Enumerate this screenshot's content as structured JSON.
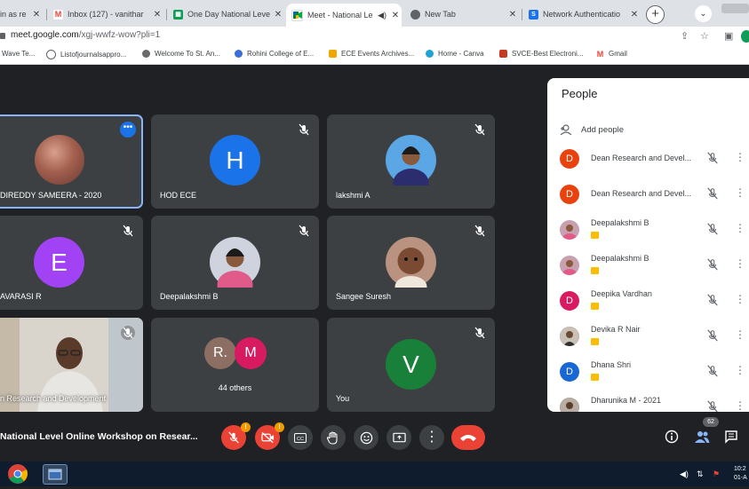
{
  "tabs": [
    {
      "title": "in as re",
      "icon": "blank-tab-icon",
      "active": false
    },
    {
      "title": "Inbox (127) - vanithar",
      "icon": "gmail-icon",
      "active": false
    },
    {
      "title": "One Day National Leve",
      "icon": "sheets-icon",
      "active": false
    },
    {
      "title": "Meet - National Le",
      "icon": "meet-icon",
      "active": true
    },
    {
      "title": "New Tab",
      "icon": "chrome-icon",
      "active": false
    },
    {
      "title": "Network Authenticatio",
      "icon": "network-auth-icon",
      "active": false
    }
  ],
  "address": {
    "host": "meet.google.com",
    "path": "/xgj-wwfz-wow?pli=1"
  },
  "bookmarks": [
    {
      "label": "Wave Te...",
      "color": "#4a7bd4"
    },
    {
      "label": "Listofjournalsappro...",
      "color": "#5f6368"
    },
    {
      "label": "Welcome To St. An...",
      "color": "#6b6b6b"
    },
    {
      "label": "Rohini College of E...",
      "color": "#3b6fd6"
    },
    {
      "label": "ECE Events Archives...",
      "color": "#f2a600"
    },
    {
      "label": "Home - Canva",
      "color": "#1fa3d6"
    },
    {
      "label": "SVCE-Best Electroni...",
      "color": "#c23b22"
    },
    {
      "label": "Gmail",
      "color": "#ea4335"
    }
  ],
  "tiles": [
    {
      "name": "DIREDDY SAMEERA - 2020",
      "initial": "",
      "avatarColor": "#8d5a4a"
    },
    {
      "name": "HOD ECE",
      "initial": "H",
      "avatarColor": "#1a73e8"
    },
    {
      "name": "lakshmi A",
      "initial": "",
      "avatarColor": "#5ba7e6"
    },
    {
      "name": "AVARASI R",
      "initial": "E",
      "avatarColor": "#a142f4"
    },
    {
      "name": "Deepalakshmi B",
      "initial": "",
      "avatarColor": "#b7b7c7"
    },
    {
      "name": "Sangee Suresh",
      "initial": "",
      "avatarColor": "#a87c66"
    },
    {
      "name": "n Research and Development",
      "initial": "",
      "avatarColor": ""
    },
    {
      "name": "44 others",
      "initial": "R.",
      "initial2": "M",
      "avatarColor": "#8d6e63",
      "avatarColor2": "#d81b60"
    },
    {
      "name": "You",
      "initial": "V",
      "avatarColor": "#188038"
    }
  ],
  "people": {
    "title": "People",
    "add_label": "Add people",
    "count": "62",
    "list": [
      {
        "name": "Dean Research and Devel...",
        "initial": "D",
        "color": "#e8430e",
        "badge": false
      },
      {
        "name": "Dean Research and Devel...",
        "initial": "D",
        "color": "#e8430e",
        "badge": false
      },
      {
        "name": "Deepalakshmi B",
        "initial": "",
        "color": "#c8a0b0",
        "badge": true
      },
      {
        "name": "Deepalakshmi B",
        "initial": "",
        "color": "#c8a0b0",
        "badge": true
      },
      {
        "name": "Deepika Vardhan",
        "initial": "D",
        "color": "#d81b60",
        "badge": true
      },
      {
        "name": "Devika R Nair",
        "initial": "",
        "color": "#7a6a60",
        "badge": true
      },
      {
        "name": "Dhana Shri",
        "initial": "D",
        "color": "#1967d2",
        "badge": true
      },
      {
        "name": "Dharunika M - 2021",
        "initial": "",
        "color": "#8a7a70",
        "badge": false
      }
    ]
  },
  "meeting_title": "National Level Online Workshop on Resear...",
  "taskbar": {
    "time": "10:2",
    "date": "01-A"
  }
}
